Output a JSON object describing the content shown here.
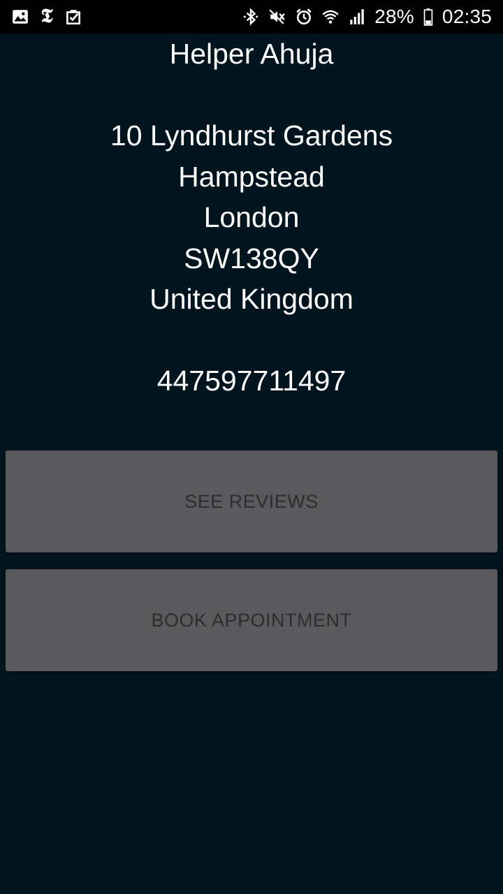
{
  "status_bar": {
    "left_icons": [
      "image-icon",
      "nyt-icon",
      "clipboard-check-icon"
    ],
    "nyt_glyph": "𝕿",
    "right_icons": [
      "bluetooth-icon",
      "mute-icon",
      "alarm-icon",
      "wifi-icon",
      "signal-icon"
    ],
    "battery_percent": "28%",
    "battery_fill": 0.28,
    "time": "02:35"
  },
  "helper": {
    "name": "Helper Ahuja",
    "address": {
      "line1": "10 Lyndhurst Gardens",
      "line2": "Hampstead",
      "city": "London",
      "postcode": "SW138QY",
      "country": "United Kingdom"
    },
    "phone": "447597711497"
  },
  "actions": {
    "see_reviews_label": "SEE REVIEWS",
    "book_appointment_label": "BOOK APPOINTMENT"
  },
  "colors": {
    "background": "#02151e",
    "status_bar": "#000000",
    "button_bg": "#5a5a5c",
    "button_text": "#2d2d2f",
    "text": "#ffffff"
  }
}
